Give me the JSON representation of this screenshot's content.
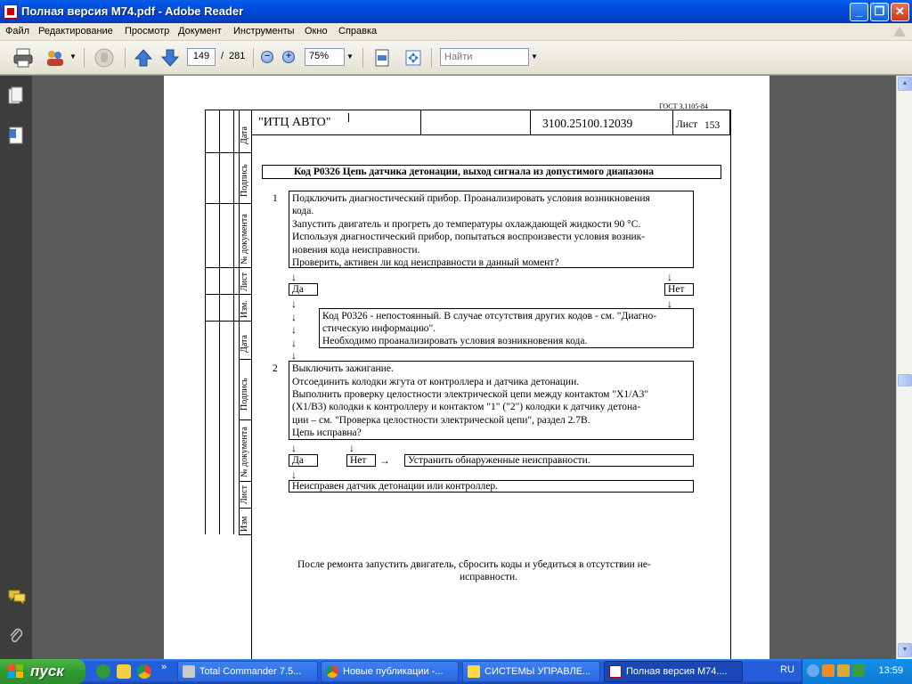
{
  "window": {
    "title": "Полная версия М74.pdf - Adobe Reader",
    "minimize": "_",
    "restore": "❐",
    "close": "✕"
  },
  "menu": [
    "Файл",
    "Редактирование",
    "Просмотр",
    "Документ",
    "Инструменты",
    "Окно",
    "Справка"
  ],
  "toolbar": {
    "current_page": "149",
    "page_separator": "/",
    "total_pages": "281",
    "zoom": "75%",
    "search_placeholder": "Найти",
    "zoom_out": "−",
    "zoom_in": "+"
  },
  "document": {
    "gost": "ГОСТ 3.1105-84",
    "org": "\"ИТЦ АВТО\"",
    "doc_number": "3100.25100.12039",
    "sheet_label": "Лист",
    "sheet_number": "153",
    "side_labels_top": [
      "Дата",
      "Подпись",
      "№ документа",
      "Лист",
      "Изм."
    ],
    "side_labels_bottom": [
      "Дата",
      "Подпись",
      "№ документа",
      "Лист",
      "Изм"
    ],
    "heading": "Код P0326 Цепь датчика детонации, выход сигнала из допустимого диапазона",
    "step1_num": "1",
    "step1_lines": [
      "Подключить диагностический прибор. Проанализировать условия возникновения",
      "кода.",
      "Запустить двигатель и прогреть до температуры охлаждающей жидкости 90 °С.",
      "Используя диагностический прибор, попытаться воспроизвести условия возник-",
      "новения кода неисправности.",
      "Проверить, активен ли код неисправности в данный момент?"
    ],
    "yes": "Да",
    "no": "Нет",
    "intermittent_lines": [
      "Код P0326 - непостоянный. В случае отсутствия других кодов - см. \"Диагно-",
      "стическую информацию\".",
      "Необходимо проанализировать условия возникновения кода."
    ],
    "step2_num": "2",
    "step2_lines": [
      "Выключить зажигание.",
      "Отсоединить колодки жгута от контроллера и датчика детонации.",
      "Выполнить проверку целостности электрической цепи между контактом \"X1/А3\"",
      "(X1/В3) колодки к контроллеру и контактом \"1\" (\"2\") колодки к датчику детона-",
      "ции – см. \"Проверка целостности электрической цепи\", раздел 2.7В.",
      "Цепь исправна?"
    ],
    "fix_action": "Устранить обнаруженные неисправности.",
    "faulty_sensor": "Неисправен датчик детонации или контроллер.",
    "footer_lines": [
      "После ремонта запустить двигатель, сбросить коды и убедиться в отсутствии не-",
      "исправности."
    ],
    "arrow_down": "↓",
    "arrow_right": "→"
  },
  "taskbar": {
    "start": "пуск",
    "more": "»",
    "tasks": [
      {
        "label": "Total Commander 7.5...",
        "active": false
      },
      {
        "label": "Новые публикации -...",
        "active": false
      },
      {
        "label": "СИСТЕМЫ УПРАВЛЕ...",
        "active": false
      },
      {
        "label": "Полная версия М74....",
        "active": true
      }
    ],
    "lang": "RU",
    "time": "13:59"
  },
  "colors": {
    "titlebar": "#0055e5",
    "taskbar": "#245edb",
    "start": "#309a30",
    "navpane": "#3d3d3d",
    "canvas": "#5a5a5a"
  },
  "icons": [
    "app-pdf-icon",
    "print-icon",
    "collaborate-icon",
    "hand-icon",
    "prev-page-icon",
    "next-page-icon",
    "fit-page-icon",
    "fit-width-icon",
    "pages-icon",
    "attachments-icon",
    "comments-icon",
    "paperclip-icon"
  ]
}
